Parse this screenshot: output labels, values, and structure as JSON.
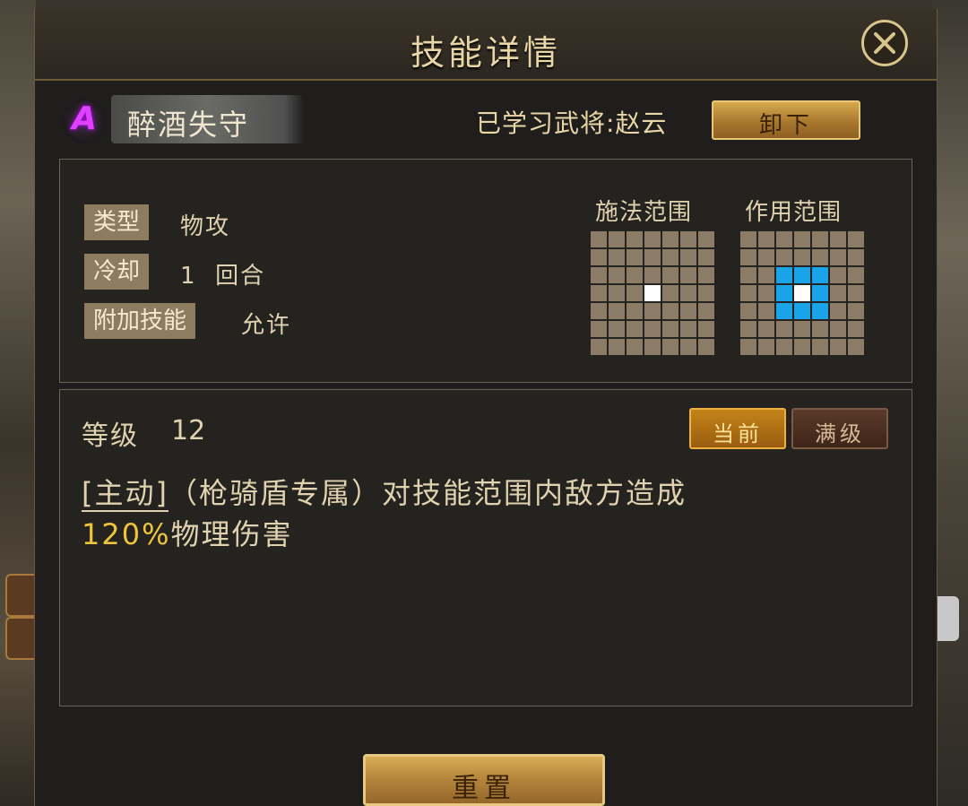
{
  "title": "技能详情",
  "skill": {
    "grade": "A",
    "name": "醉酒失守",
    "learned_by": "已学习武将:赵云",
    "unload_label": "卸下"
  },
  "info": {
    "type_tag": "类型",
    "type_value": "物攻",
    "cooldown_tag": "冷却",
    "cooldown_value": "1  回合",
    "extra_tag": "附加技能",
    "extra_value": "允许",
    "cast_range_label": "施法范围",
    "effect_range_label": "作用范围"
  },
  "colors": {
    "grid_cell": "#8c7b67",
    "center_cell": "#ffffff",
    "effect_cell": "#1aa3e8",
    "accent_gold": "#f0c43a"
  },
  "detail": {
    "level_label": "等级",
    "level_value": "12",
    "tab_current": "当前",
    "tab_max": "满级",
    "desc_active": "[主动]",
    "desc_rest_1": "（枪骑盾专属）对技能范围内敌方造成",
    "desc_pct": "120%",
    "desc_rest_2": "物理伤害"
  },
  "reset_label": "重置"
}
